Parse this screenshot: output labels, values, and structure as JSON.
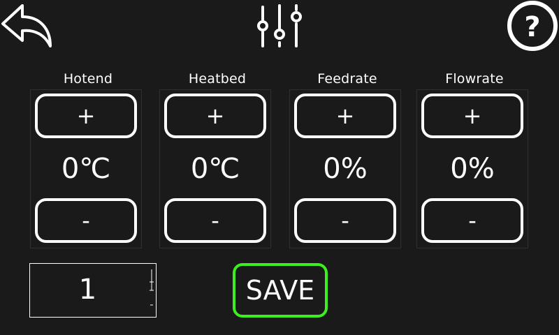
{
  "toolbar": {
    "back_icon": "back-arrow-icon",
    "title_icon": "sliders-icon",
    "help_icon": "help-icon",
    "help_glyph": "?"
  },
  "panels": [
    {
      "label": "Hotend",
      "plus": "+",
      "value": "0℃",
      "minus": "-"
    },
    {
      "label": "Heatbed",
      "plus": "+",
      "value": "0℃",
      "minus": "-"
    },
    {
      "label": "Feedrate",
      "plus": "+",
      "value": "0%",
      "minus": "-"
    },
    {
      "label": "Flowrate",
      "plus": "+",
      "value": "0%",
      "minus": "-"
    }
  ],
  "step": {
    "value": "1"
  },
  "save": {
    "label": "SAVE"
  },
  "colors": {
    "background": "#1a1a1a",
    "save_border": "#3cf020",
    "foreground": "#ffffff"
  }
}
